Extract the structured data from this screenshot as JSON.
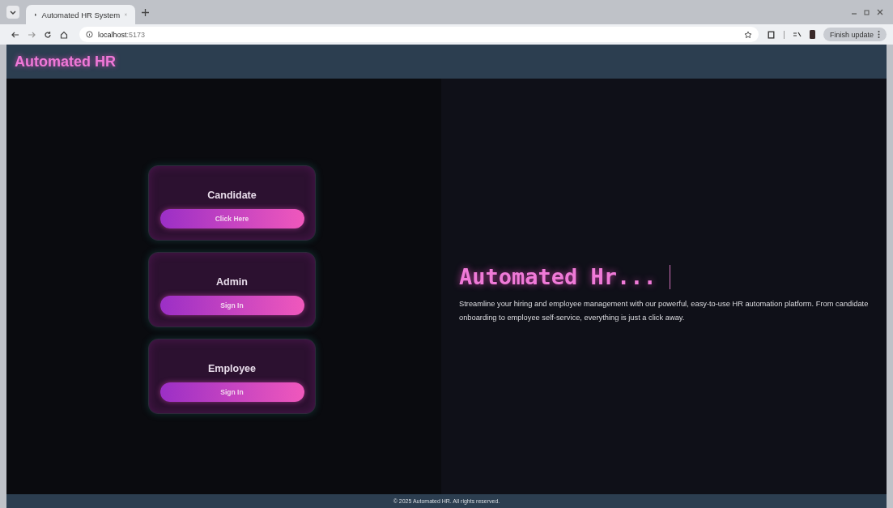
{
  "browser": {
    "tab_title": "Automated HR System",
    "url_host": "localhost",
    "url_port": ":5173",
    "update_button": "Finish update"
  },
  "header": {
    "brand": "Automated HR"
  },
  "role_cards": [
    {
      "title": "Candidate",
      "button": "Click Here"
    },
    {
      "title": "Admin",
      "button": "Sign In"
    },
    {
      "title": "Employee",
      "button": "Sign In"
    }
  ],
  "hero": {
    "heading": "Automated Hr...",
    "description": "Streamline your hiring and employee management with our powerful, easy-to-use HR automation platform. From candidate onboarding to employee self-service, everything is just a click away."
  },
  "footer": {
    "text": "© 2025 Automated HR. All rights reserved."
  }
}
